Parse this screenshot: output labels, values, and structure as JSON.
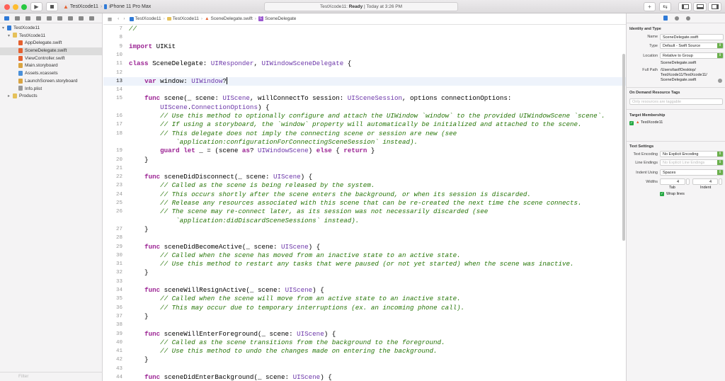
{
  "toolbar": {
    "scheme_name": "TestXcode11",
    "device_name": "iPhone 11 Pro Max",
    "status_project": "TestXcode11:",
    "status_state": "Ready",
    "status_time": "| Today at 3:26 PM",
    "colors": {
      "close": "#ff5f57",
      "minimize": "#febc2e",
      "zoom": "#28c840"
    }
  },
  "navigator": {
    "tree": [
      {
        "label": "TestXcode11",
        "indent": 0,
        "kind": "project",
        "disclosure": "▾"
      },
      {
        "label": "TestXcode11",
        "indent": 1,
        "kind": "folder",
        "disclosure": "▾"
      },
      {
        "label": "AppDelegate.swift",
        "indent": 2,
        "kind": "swift"
      },
      {
        "label": "SceneDelegate.swift",
        "indent": 2,
        "kind": "swift",
        "selected": true
      },
      {
        "label": "ViewController.swift",
        "indent": 2,
        "kind": "swift"
      },
      {
        "label": "Main.storyboard",
        "indent": 2,
        "kind": "storyboard"
      },
      {
        "label": "Assets.xcassets",
        "indent": 2,
        "kind": "assets"
      },
      {
        "label": "LaunchScreen.storyboard",
        "indent": 2,
        "kind": "storyboard"
      },
      {
        "label": "Info.plist",
        "indent": 2,
        "kind": "plist"
      },
      {
        "label": "Products",
        "indent": 1,
        "kind": "folder",
        "disclosure": "▸"
      }
    ],
    "filter_placeholder": "Filter"
  },
  "jumpbar": {
    "crumbs": [
      "TestXcode11",
      "TestXcode11",
      "SceneDelegate.swift",
      "SceneDelegate"
    ]
  },
  "editor": {
    "current_line": "13",
    "lines": [
      {
        "n": "7",
        "t": [
          [
            "cm",
            "//"
          ]
        ]
      },
      {
        "n": "8",
        "t": []
      },
      {
        "n": "9",
        "t": [
          [
            "kw",
            "import"
          ],
          [
            "",
            " UIKit"
          ]
        ]
      },
      {
        "n": "10",
        "t": []
      },
      {
        "n": "11",
        "t": [
          [
            "kw",
            "class"
          ],
          [
            "",
            " SceneDelegate: "
          ],
          [
            "ty",
            "UIResponder"
          ],
          [
            "",
            ", "
          ],
          [
            "ty",
            "UIWindowSceneDelegate"
          ],
          [
            "",
            " {"
          ]
        ]
      },
      {
        "n": "12",
        "t": []
      },
      {
        "n": "13",
        "t": [
          [
            "",
            "    "
          ],
          [
            "kw",
            "var"
          ],
          [
            "",
            " window: "
          ],
          [
            "ty",
            "UIWindow"
          ],
          [
            "",
            "?"
          ]
        ]
      },
      {
        "n": "14",
        "t": []
      },
      {
        "n": "15",
        "t": [
          [
            "",
            "    "
          ],
          [
            "kw",
            "func"
          ],
          [
            "",
            " scene(_ scene: "
          ],
          [
            "ty",
            "UIScene"
          ],
          [
            "",
            ", willConnectTo session: "
          ],
          [
            "ty",
            "UISceneSession"
          ],
          [
            "",
            ", options connectionOptions:"
          ]
        ]
      },
      {
        "n": "",
        "t": [
          [
            "",
            "        "
          ],
          [
            "ty",
            "UIScene"
          ],
          [
            "",
            "."
          ],
          [
            "ty",
            "ConnectionOptions"
          ],
          [
            "",
            ") {"
          ]
        ]
      },
      {
        "n": "16",
        "t": [
          [
            "",
            "        "
          ],
          [
            "cm",
            "// Use this method to optionally configure and attach the UIWindow `window` to the provided UIWindowScene `scene`."
          ]
        ]
      },
      {
        "n": "17",
        "t": [
          [
            "",
            "        "
          ],
          [
            "cm",
            "// If using a storyboard, the `window` property will automatically be initialized and attached to the scene."
          ]
        ]
      },
      {
        "n": "18",
        "t": [
          [
            "",
            "        "
          ],
          [
            "cm",
            "// This delegate does not imply the connecting scene or session are new (see"
          ]
        ]
      },
      {
        "n": "",
        "t": [
          [
            "",
            "            "
          ],
          [
            "cm",
            "`application:configurationForConnectingSceneSession` instead)."
          ]
        ]
      },
      {
        "n": "19",
        "t": [
          [
            "",
            "        "
          ],
          [
            "kw",
            "guard"
          ],
          [
            "",
            " "
          ],
          [
            "kw",
            "let"
          ],
          [
            "",
            " _ = (scene "
          ],
          [
            "kw",
            "as"
          ],
          [
            "",
            "? "
          ],
          [
            "ty",
            "UIWindowScene"
          ],
          [
            "",
            ") "
          ],
          [
            "kw",
            "else"
          ],
          [
            "",
            " { "
          ],
          [
            "kw",
            "return"
          ],
          [
            "",
            " }"
          ]
        ]
      },
      {
        "n": "20",
        "t": [
          [
            "",
            "    }"
          ]
        ]
      },
      {
        "n": "21",
        "t": []
      },
      {
        "n": "22",
        "t": [
          [
            "",
            "    "
          ],
          [
            "kw",
            "func"
          ],
          [
            "",
            " sceneDidDisconnect(_ scene: "
          ],
          [
            "ty",
            "UIScene"
          ],
          [
            "",
            ") {"
          ]
        ]
      },
      {
        "n": "23",
        "t": [
          [
            "",
            "        "
          ],
          [
            "cm",
            "// Called as the scene is being released by the system."
          ]
        ]
      },
      {
        "n": "24",
        "t": [
          [
            "",
            "        "
          ],
          [
            "cm",
            "// This occurs shortly after the scene enters the background, or when its session is discarded."
          ]
        ]
      },
      {
        "n": "25",
        "t": [
          [
            "",
            "        "
          ],
          [
            "cm",
            "// Release any resources associated with this scene that can be re-created the next time the scene connects."
          ]
        ]
      },
      {
        "n": "26",
        "t": [
          [
            "",
            "        "
          ],
          [
            "cm",
            "// The scene may re-connect later, as its session was not necessarily discarded (see"
          ]
        ]
      },
      {
        "n": "",
        "t": [
          [
            "",
            "            "
          ],
          [
            "cm",
            "`application:didDiscardSceneSessions` instead)."
          ]
        ]
      },
      {
        "n": "27",
        "t": [
          [
            "",
            "    }"
          ]
        ]
      },
      {
        "n": "28",
        "t": []
      },
      {
        "n": "29",
        "t": [
          [
            "",
            "    "
          ],
          [
            "kw",
            "func"
          ],
          [
            "",
            " sceneDidBecomeActive(_ scene: "
          ],
          [
            "ty",
            "UIScene"
          ],
          [
            "",
            ") {"
          ]
        ]
      },
      {
        "n": "30",
        "t": [
          [
            "",
            "        "
          ],
          [
            "cm",
            "// Called when the scene has moved from an inactive state to an active state."
          ]
        ]
      },
      {
        "n": "31",
        "t": [
          [
            "",
            "        "
          ],
          [
            "cm",
            "// Use this method to restart any tasks that were paused (or not yet started) when the scene was inactive."
          ]
        ]
      },
      {
        "n": "32",
        "t": [
          [
            "",
            "    }"
          ]
        ]
      },
      {
        "n": "33",
        "t": []
      },
      {
        "n": "34",
        "t": [
          [
            "",
            "    "
          ],
          [
            "kw",
            "func"
          ],
          [
            "",
            " sceneWillResignActive(_ scene: "
          ],
          [
            "ty",
            "UIScene"
          ],
          [
            "",
            ") {"
          ]
        ]
      },
      {
        "n": "35",
        "t": [
          [
            "",
            "        "
          ],
          [
            "cm",
            "// Called when the scene will move from an active state to an inactive state."
          ]
        ]
      },
      {
        "n": "36",
        "t": [
          [
            "",
            "        "
          ],
          [
            "cm",
            "// This may occur due to temporary interruptions (ex. an incoming phone call)."
          ]
        ]
      },
      {
        "n": "37",
        "t": [
          [
            "",
            "    }"
          ]
        ]
      },
      {
        "n": "38",
        "t": []
      },
      {
        "n": "39",
        "t": [
          [
            "",
            "    "
          ],
          [
            "kw",
            "func"
          ],
          [
            "",
            " sceneWillEnterForeground(_ scene: "
          ],
          [
            "ty",
            "UIScene"
          ],
          [
            "",
            ") {"
          ]
        ]
      },
      {
        "n": "40",
        "t": [
          [
            "",
            "        "
          ],
          [
            "cm",
            "// Called as the scene transitions from the background to the foreground."
          ]
        ]
      },
      {
        "n": "41",
        "t": [
          [
            "",
            "        "
          ],
          [
            "cm",
            "// Use this method to undo the changes made on entering the background."
          ]
        ]
      },
      {
        "n": "42",
        "t": [
          [
            "",
            "    }"
          ]
        ]
      },
      {
        "n": "43",
        "t": []
      },
      {
        "n": "44",
        "t": [
          [
            "",
            "    "
          ],
          [
            "kw",
            "func"
          ],
          [
            "",
            " sceneDidEnterBackground(_ scene: "
          ],
          [
            "ty",
            "UIScene"
          ],
          [
            "",
            ") {"
          ]
        ]
      }
    ]
  },
  "inspector": {
    "identity": {
      "heading": "Identity and Type",
      "name_label": "Name",
      "name_value": "SceneDelegate.swift",
      "type_label": "Type",
      "type_value": "Default - Swift Source",
      "location_label": "Location",
      "location_value": "Relative to Group",
      "location_file": "SceneDelegate.swift",
      "fullpath_label": "Full Path",
      "fullpath_lines": [
        "/Users/taof/Desktop/",
        "TestXcode11/TestXcode11/",
        "SceneDelegate.swift"
      ]
    },
    "ondemand": {
      "heading": "On Demand Resource Tags",
      "placeholder": "Only resources are taggable"
    },
    "membership": {
      "heading": "Target Membership",
      "target": "TestXcode11"
    },
    "text_settings": {
      "heading": "Text Settings",
      "encoding_label": "Text Encoding",
      "encoding_value": "No Explicit Encoding",
      "line_endings_label": "Line Endings",
      "line_endings_value": "No Explicit Line Endings",
      "indent_using_label": "Indent Using",
      "indent_using_value": "Spaces",
      "widths_label": "Widths",
      "tab_value": "4",
      "indent_value": "4",
      "tab_label": "Tab",
      "indent_label": "Indent",
      "wrap_label": "Wrap lines"
    }
  }
}
